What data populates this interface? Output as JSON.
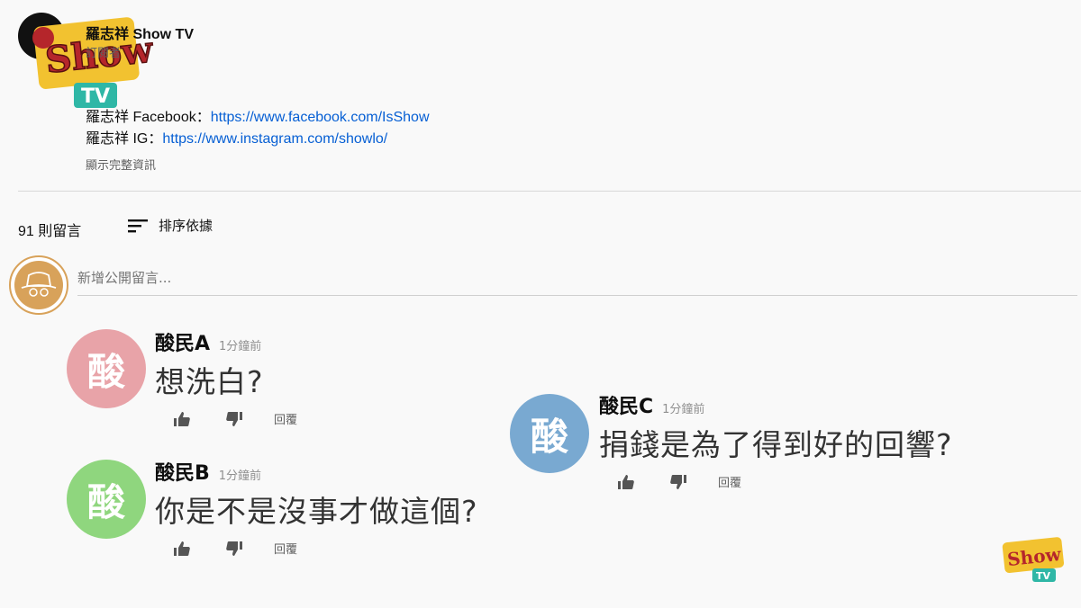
{
  "channel": {
    "name": "羅志祥 Show TV",
    "subscribers": "訂閱者",
    "description": [
      {
        "label": "羅志祥 Facebook：",
        "link": "https://www.facebook.com/IsShow"
      },
      {
        "label": "羅志祥 IG：",
        "link": "https://www.instagram.com/showlo/"
      }
    ],
    "show_more": "顯示完整資訊",
    "logo_text": "Show TV"
  },
  "comments_header": {
    "count": "91 則留言",
    "sort_label": "排序依據",
    "input_placeholder": "新增公開留言..."
  },
  "comments": [
    {
      "avatar": "酸",
      "author": "酸民A",
      "time": "1分鐘前",
      "text": "想洗白?",
      "reply": "回覆",
      "color": "#e8a3a8"
    },
    {
      "avatar": "酸",
      "author": "酸民B",
      "time": "1分鐘前",
      "text": "你是不是沒事才做這個?",
      "reply": "回覆",
      "color": "#8fd67e"
    },
    {
      "avatar": "酸",
      "author": "酸民C",
      "time": "1分鐘前",
      "text": "捐錢是為了得到好的回響?",
      "reply": "回覆",
      "color": "#79a9d1"
    }
  ],
  "watermark": "Show TV"
}
